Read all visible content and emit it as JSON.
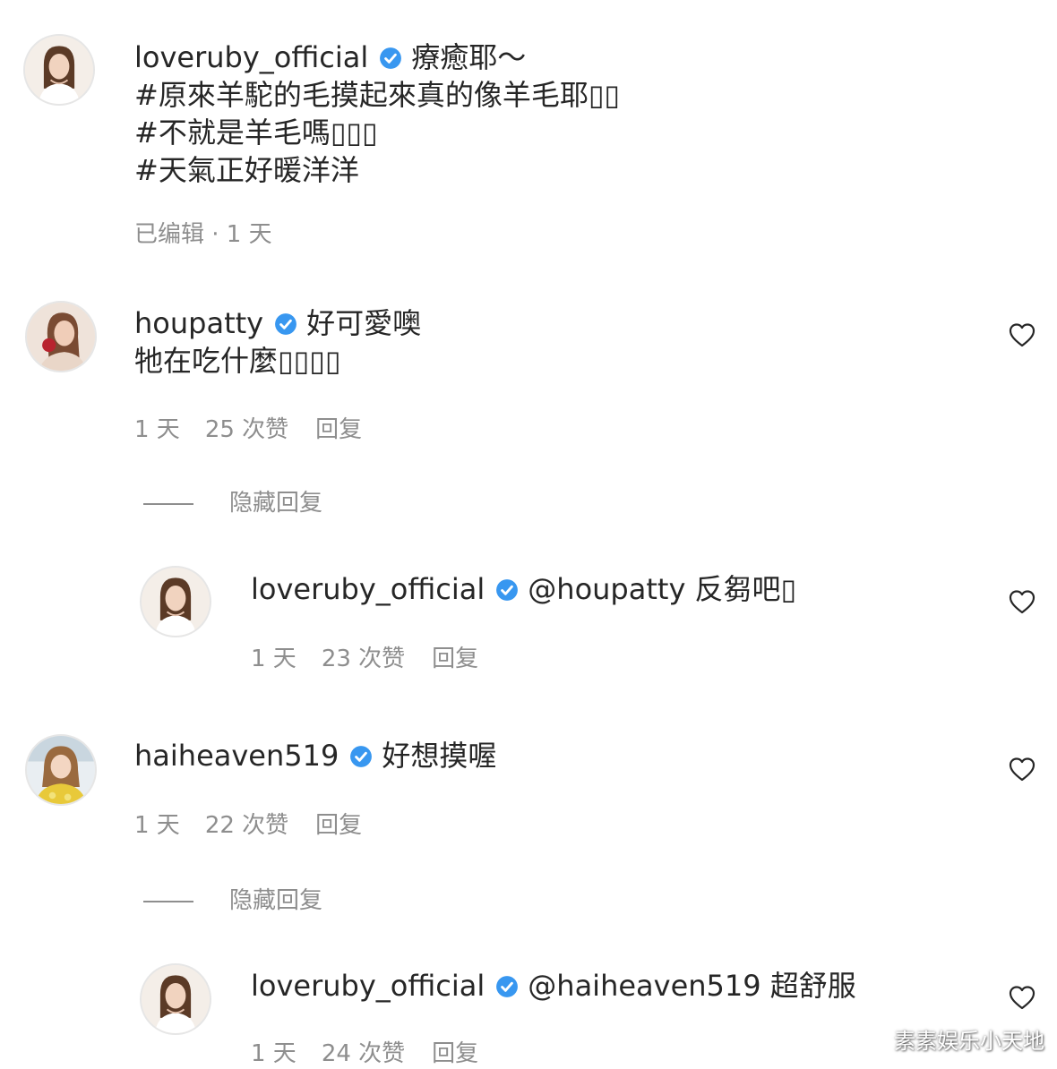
{
  "post": {
    "username": "loveruby_official",
    "verified": true,
    "caption_lines": [
      "療癒耶～",
      "#原來羊駝的毛摸起來真的像羊毛耶▯▯",
      "#不就是羊毛嗎▯▯▯",
      "#天氣正好暖洋洋"
    ],
    "meta": "已编辑 · 1 天"
  },
  "comments": [
    {
      "username": "houpatty",
      "verified": true,
      "text_lines": [
        "好可愛噢",
        "牠在吃什麼▯▯▯▯"
      ],
      "time": "1 天",
      "likes": "25 次赞",
      "reply_label": "回复",
      "hide_replies_label": "隐藏回复",
      "reply": {
        "username": "loveruby_official",
        "verified": true,
        "text": "@houpatty 反芻吧▯",
        "time": "1 天",
        "likes": "23 次赞",
        "reply_label": "回复"
      }
    },
    {
      "username": "haiheaven519",
      "verified": true,
      "text_lines": [
        "好想摸喔"
      ],
      "time": "1 天",
      "likes": "22 次赞",
      "reply_label": "回复",
      "hide_replies_label": "隐藏回复",
      "reply": {
        "username": "loveruby_official",
        "verified": true,
        "text": "@haiheaven519 超舒服",
        "time": "1 天",
        "likes": "24 次赞",
        "reply_label": "回复"
      }
    }
  ],
  "icons": {
    "verified": "verified-badge-icon",
    "like": "heart-outline-icon"
  },
  "colors": {
    "verified_blue": "#3897f0",
    "meta_gray": "#8e8e8e",
    "text": "#262626"
  },
  "watermark": "素素娱乐小天地"
}
